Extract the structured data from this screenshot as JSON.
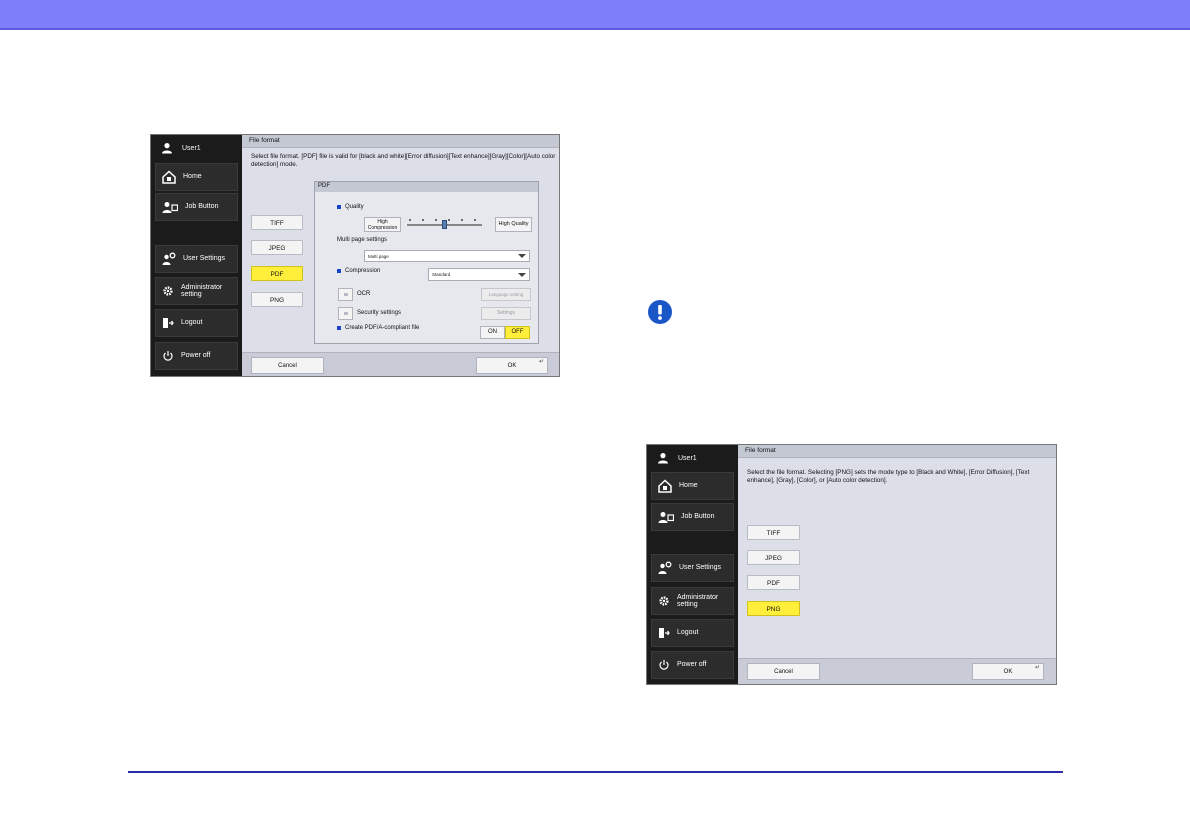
{
  "colors": {
    "header_band": "#7f7ffb",
    "rule": "#2b2ba8",
    "selected": "#ffef3a",
    "sidebar": "#1b1b1b",
    "panel": "#dcdfe8",
    "warning": "#1a56c8"
  },
  "shot1": {
    "sidebar": {
      "user": "User1",
      "items": [
        "Home",
        "Job Button",
        "User Settings",
        "Administrator setting",
        "Logout",
        "Power off"
      ]
    },
    "title": "File format",
    "description": "Select file format. [PDF] file is valid for [black and white][Error diffusion][Text enhance][Gray][Color][Auto color detection] mode.",
    "formats": [
      "TIFF",
      "JPEG",
      "PDF",
      "PNG"
    ],
    "selected_format": "PDF",
    "pdf": {
      "header": "PDF",
      "quality_label": "Quality",
      "high_compression": "High Compression",
      "high_quality": "High Quality",
      "quality_level": 0.5,
      "multipage_label": "Multi page settings",
      "multipage_value": "Multi page",
      "compression_label": "Compression",
      "compression_value": "Standard",
      "ocr_label": "OCR",
      "language_setting": "Language setting",
      "security_label": "Security settings",
      "settings_button": "Settings",
      "pdfa_label": "Create PDF/A-compliant file",
      "on": "ON",
      "off": "OFF"
    },
    "cancel": "Cancel",
    "ok": "OK"
  },
  "shot2": {
    "sidebar": {
      "user": "User1",
      "items": [
        "Home",
        "Job Button",
        "User Settings",
        "Administrator setting",
        "Logout",
        "Power off"
      ]
    },
    "title": "File format",
    "description": "Select the file format. Selecting [PNG] sets the mode type to [Black and White], [Error Diffusion], [Text enhance], [Gray], [Color], or [Auto color detection].",
    "formats": [
      "TIFF",
      "JPEG",
      "PDF",
      "PNG"
    ],
    "selected_format": "PNG",
    "cancel": "Cancel",
    "ok": "OK"
  }
}
